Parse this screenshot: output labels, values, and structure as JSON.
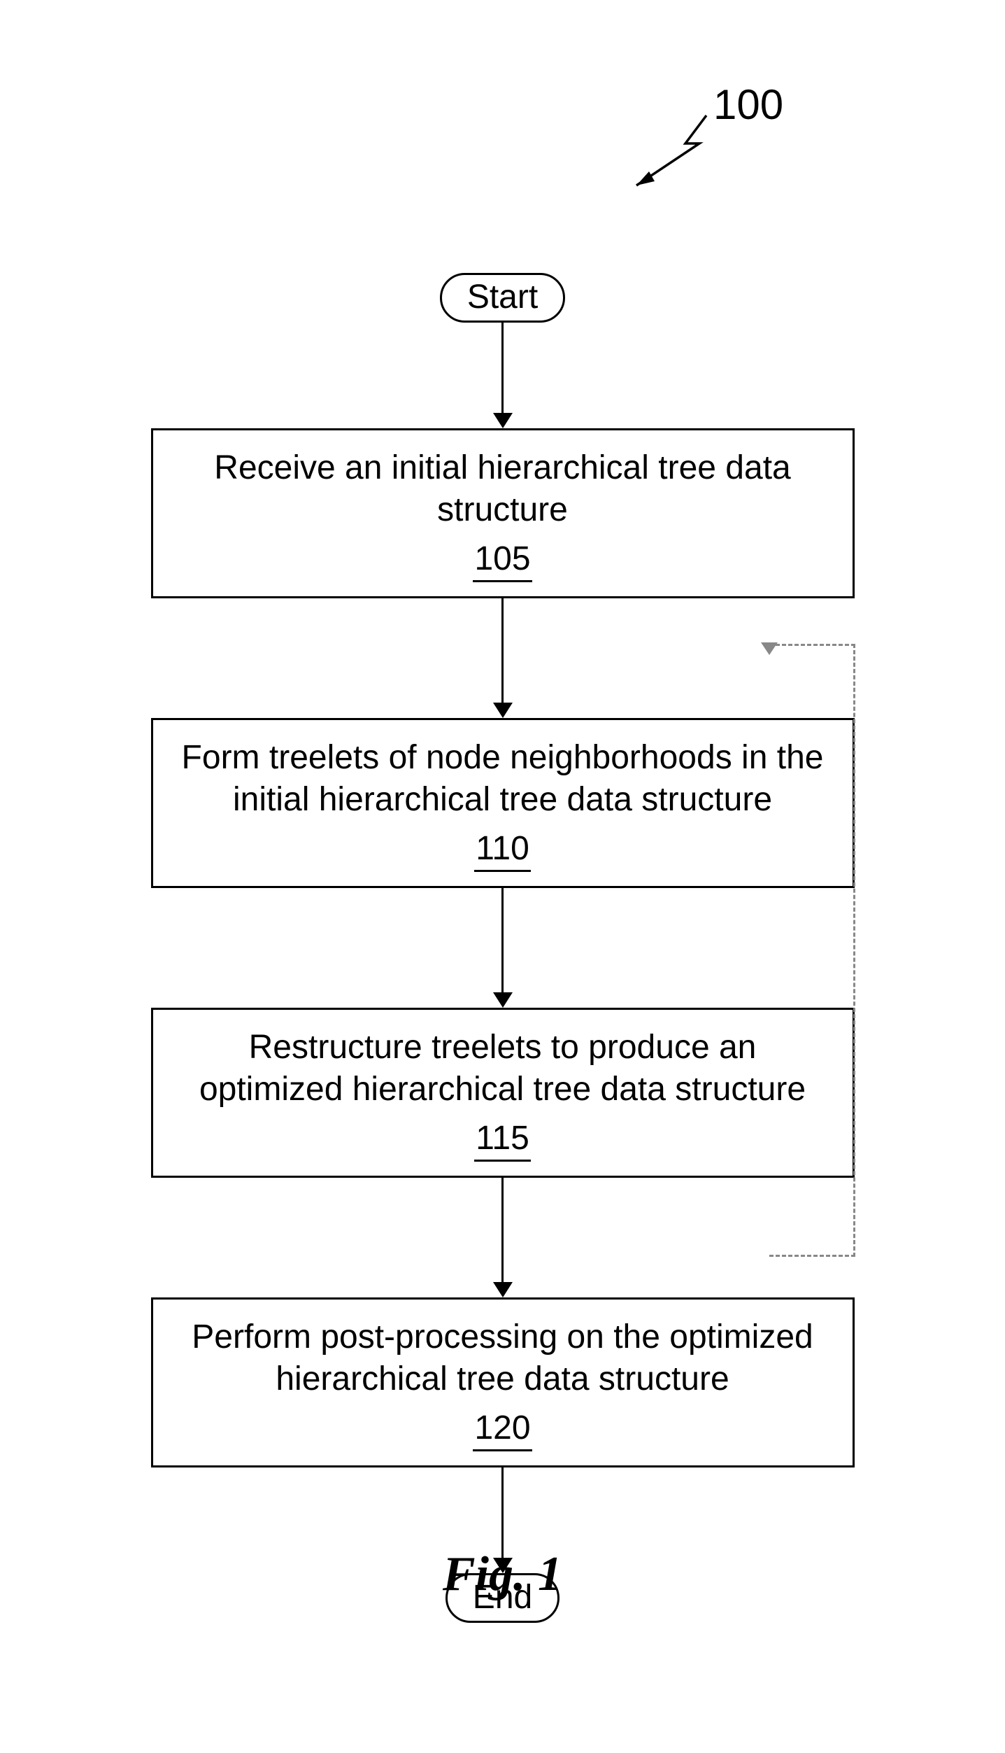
{
  "figure": {
    "ref_number": "100",
    "caption": "Fig. 1",
    "start_label": "Start",
    "end_label": "End",
    "steps": [
      {
        "text": "Receive an initial hierarchical tree data structure",
        "num": "105"
      },
      {
        "text": "Form treelets of node neighborhoods in the initial hierarchical tree data structure",
        "num": "110"
      },
      {
        "text": "Restructure treelets to produce an optimized hierarchical tree data structure",
        "num": "115"
      },
      {
        "text": "Perform post-processing on the optimized hierarchical tree data structure",
        "num": "120"
      }
    ]
  }
}
